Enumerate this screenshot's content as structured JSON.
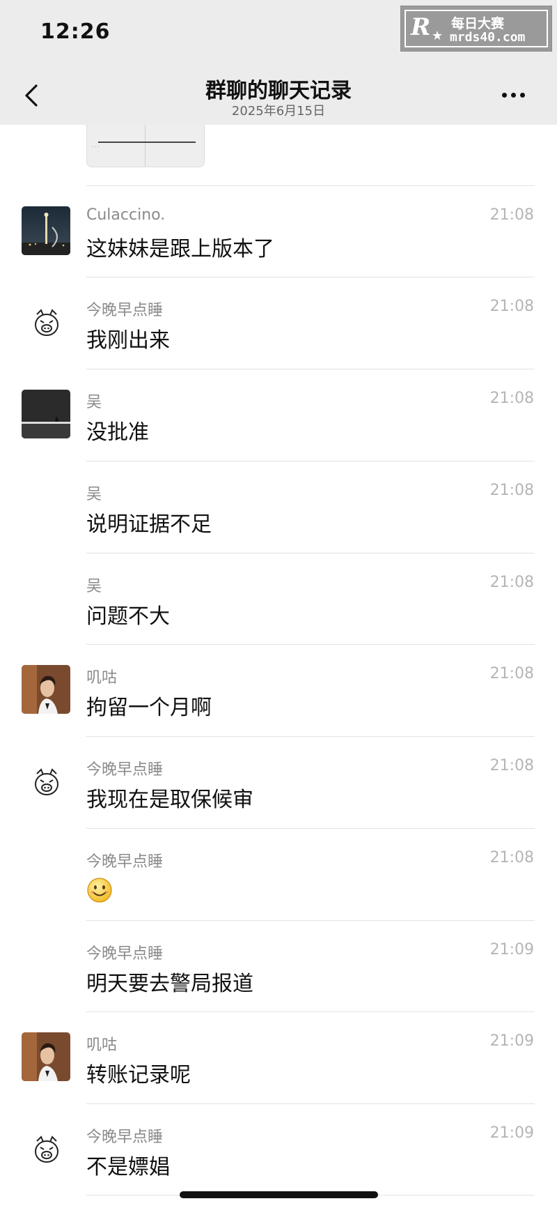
{
  "status_bar": {
    "time": "12:26"
  },
  "watermark": {
    "mark": "R",
    "cn_text": "每日大赛",
    "url": "mrds40.com"
  },
  "header": {
    "title": "群聊的聊天记录",
    "date": "2025年6月15日"
  },
  "messages": [
    {
      "sender": "Culaccino.",
      "time": "21:08",
      "text": "这妹妹是跟上版本了",
      "avatar": "night-city-photo"
    },
    {
      "sender": "今晚早点睡",
      "time": "21:08",
      "text": "我刚出来",
      "avatar": "pig-face-icon"
    },
    {
      "sender": "吴",
      "time": "21:08",
      "text": "没批准",
      "avatar": "dark-room-photo"
    },
    {
      "sender": "吴",
      "time": "21:08",
      "text": "说明证据不足",
      "avatar": ""
    },
    {
      "sender": "吴",
      "time": "21:08",
      "text": "问题不大",
      "avatar": ""
    },
    {
      "sender": "叽咕",
      "time": "21:08",
      "text": "拘留一个月啊",
      "avatar": "man-portrait-photo"
    },
    {
      "sender": "今晚早点睡",
      "time": "21:08",
      "text": "我现在是取保候审",
      "avatar": "pig-face-icon"
    },
    {
      "sender": "今晚早点睡",
      "time": "21:08",
      "text": "",
      "emoji": "smile-emoji",
      "avatar": ""
    },
    {
      "sender": "今晚早点睡",
      "time": "21:09",
      "text": "明天要去警局报道",
      "avatar": ""
    },
    {
      "sender": "叽咕",
      "time": "21:09",
      "text": "转账记录呢",
      "avatar": "man-portrait-photo"
    },
    {
      "sender": "今晚早点睡",
      "time": "21:09",
      "text": "不是嫖娼",
      "avatar": "pig-face-icon"
    }
  ]
}
